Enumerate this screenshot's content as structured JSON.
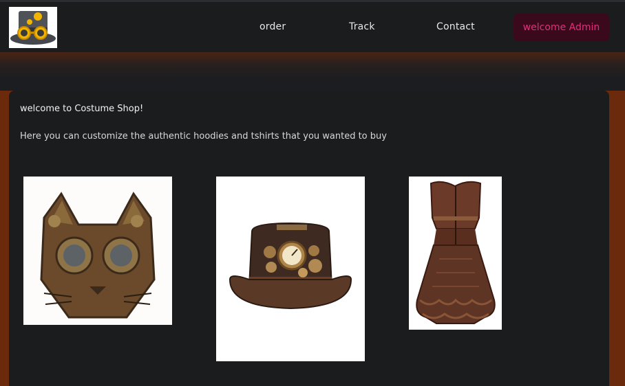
{
  "nav": {
    "logo_icon": "steampunk-hat-logo-icon",
    "links": [
      "order",
      "Track",
      "Contact"
    ],
    "admin_label": "welcome Admin"
  },
  "colors": {
    "page_frame": "#6b2a0c",
    "nav_bg": "#1b1c1e",
    "panel_bg": "#1b1c1e",
    "admin_btn_bg": "#3a0a1c",
    "admin_btn_text": "#e0307c"
  },
  "main": {
    "welcome": "welcome to Costume Shop!",
    "subtitle": "Here you can customize the authentic hoodies and tshirts that you wanted to buy",
    "products": [
      {
        "image": "steampunk-cat-mask-image"
      },
      {
        "image": "steampunk-top-hat-image"
      },
      {
        "image": "steampunk-corset-dress-image"
      }
    ]
  }
}
